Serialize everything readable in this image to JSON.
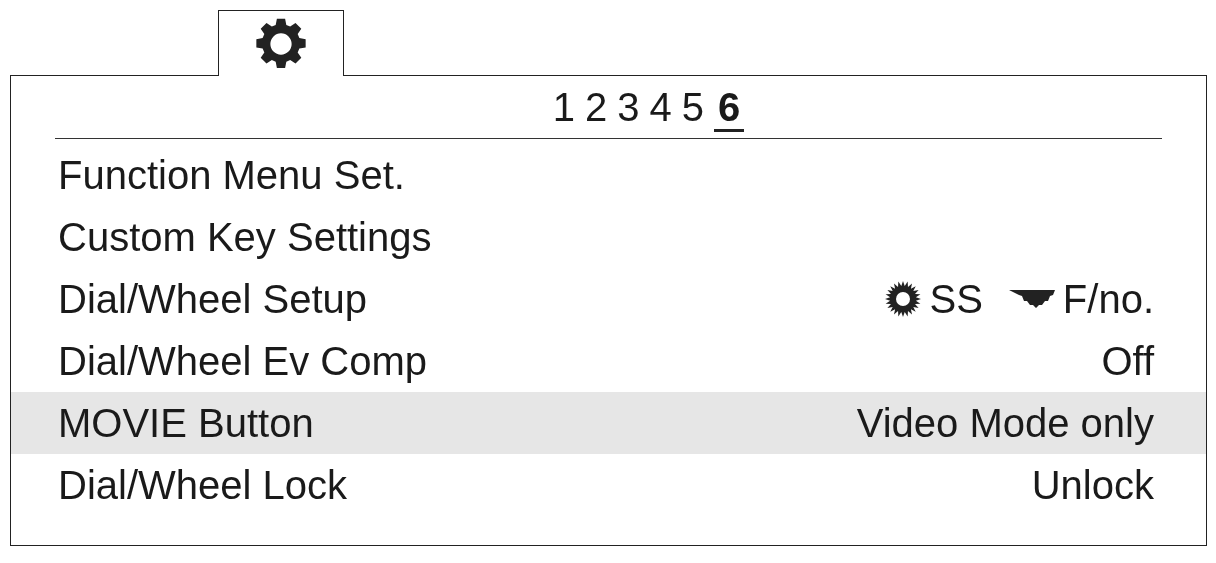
{
  "pages": [
    {
      "label": "1",
      "selected": false
    },
    {
      "label": "2",
      "selected": false
    },
    {
      "label": "3",
      "selected": false
    },
    {
      "label": "4",
      "selected": false
    },
    {
      "label": "5",
      "selected": false
    },
    {
      "label": "6",
      "selected": true
    }
  ],
  "items": [
    {
      "label": "Function Menu Set.",
      "selected": false
    },
    {
      "label": "Custom Key Settings",
      "selected": false
    },
    {
      "label": "Dial/Wheel Setup",
      "selected": false,
      "value_parts": [
        {
          "kind": "dial",
          "text": "SS"
        },
        {
          "kind": "wheel",
          "text": "F/no."
        }
      ]
    },
    {
      "label": "Dial/Wheel Ev Comp",
      "selected": false,
      "value": "Off"
    },
    {
      "label": "MOVIE Button",
      "selected": true,
      "value": "Video Mode only"
    },
    {
      "label": "Dial/Wheel Lock",
      "selected": false,
      "value": "Unlock"
    }
  ]
}
